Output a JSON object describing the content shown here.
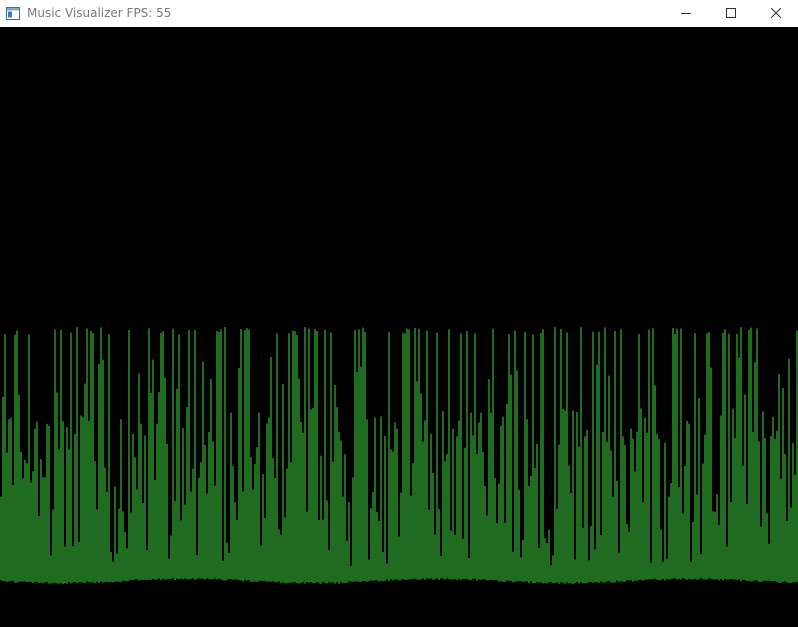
{
  "window": {
    "title": "Music Visualizer FPS: 55"
  },
  "controls": {
    "minimize_icon": "minimize-icon",
    "maximize_icon": "maximize-icon",
    "close_icon": "close-icon"
  },
  "visualizer": {
    "background_color": "#000000",
    "bar_color": "#3ed63e"
  }
}
